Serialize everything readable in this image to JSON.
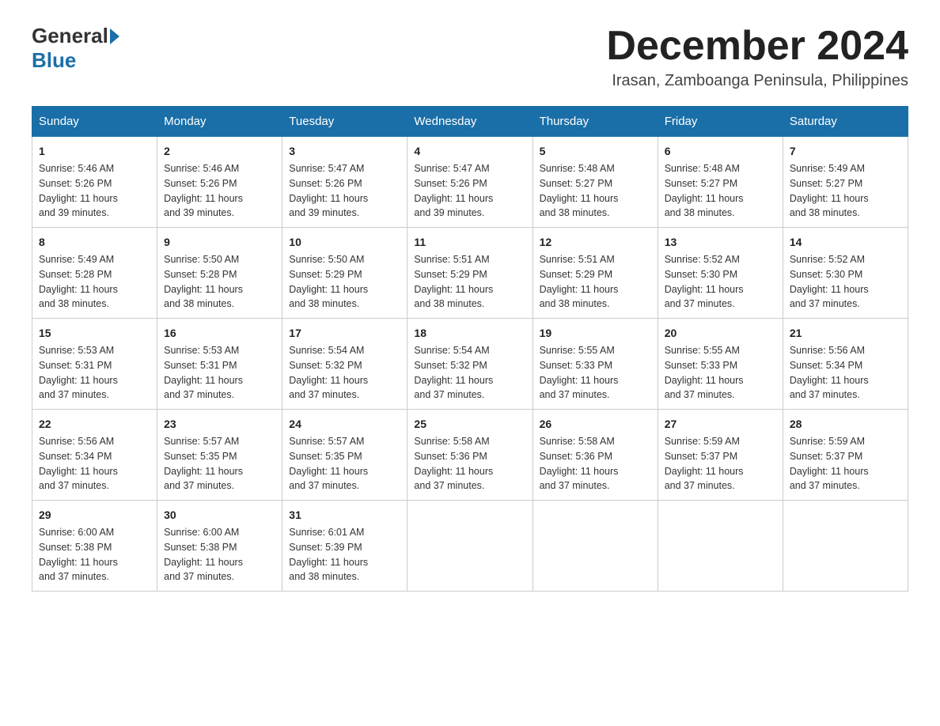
{
  "header": {
    "logo_general": "General",
    "logo_blue": "Blue",
    "month_title": "December 2024",
    "location": "Irasan, Zamboanga Peninsula, Philippines"
  },
  "weekdays": [
    "Sunday",
    "Monday",
    "Tuesday",
    "Wednesday",
    "Thursday",
    "Friday",
    "Saturday"
  ],
  "weeks": [
    [
      {
        "day": "1",
        "sunrise": "5:46 AM",
        "sunset": "5:26 PM",
        "daylight": "11 hours and 39 minutes."
      },
      {
        "day": "2",
        "sunrise": "5:46 AM",
        "sunset": "5:26 PM",
        "daylight": "11 hours and 39 minutes."
      },
      {
        "day": "3",
        "sunrise": "5:47 AM",
        "sunset": "5:26 PM",
        "daylight": "11 hours and 39 minutes."
      },
      {
        "day": "4",
        "sunrise": "5:47 AM",
        "sunset": "5:26 PM",
        "daylight": "11 hours and 39 minutes."
      },
      {
        "day": "5",
        "sunrise": "5:48 AM",
        "sunset": "5:27 PM",
        "daylight": "11 hours and 38 minutes."
      },
      {
        "day": "6",
        "sunrise": "5:48 AM",
        "sunset": "5:27 PM",
        "daylight": "11 hours and 38 minutes."
      },
      {
        "day": "7",
        "sunrise": "5:49 AM",
        "sunset": "5:27 PM",
        "daylight": "11 hours and 38 minutes."
      }
    ],
    [
      {
        "day": "8",
        "sunrise": "5:49 AM",
        "sunset": "5:28 PM",
        "daylight": "11 hours and 38 minutes."
      },
      {
        "day": "9",
        "sunrise": "5:50 AM",
        "sunset": "5:28 PM",
        "daylight": "11 hours and 38 minutes."
      },
      {
        "day": "10",
        "sunrise": "5:50 AM",
        "sunset": "5:29 PM",
        "daylight": "11 hours and 38 minutes."
      },
      {
        "day": "11",
        "sunrise": "5:51 AM",
        "sunset": "5:29 PM",
        "daylight": "11 hours and 38 minutes."
      },
      {
        "day": "12",
        "sunrise": "5:51 AM",
        "sunset": "5:29 PM",
        "daylight": "11 hours and 38 minutes."
      },
      {
        "day": "13",
        "sunrise": "5:52 AM",
        "sunset": "5:30 PM",
        "daylight": "11 hours and 37 minutes."
      },
      {
        "day": "14",
        "sunrise": "5:52 AM",
        "sunset": "5:30 PM",
        "daylight": "11 hours and 37 minutes."
      }
    ],
    [
      {
        "day": "15",
        "sunrise": "5:53 AM",
        "sunset": "5:31 PM",
        "daylight": "11 hours and 37 minutes."
      },
      {
        "day": "16",
        "sunrise": "5:53 AM",
        "sunset": "5:31 PM",
        "daylight": "11 hours and 37 minutes."
      },
      {
        "day": "17",
        "sunrise": "5:54 AM",
        "sunset": "5:32 PM",
        "daylight": "11 hours and 37 minutes."
      },
      {
        "day": "18",
        "sunrise": "5:54 AM",
        "sunset": "5:32 PM",
        "daylight": "11 hours and 37 minutes."
      },
      {
        "day": "19",
        "sunrise": "5:55 AM",
        "sunset": "5:33 PM",
        "daylight": "11 hours and 37 minutes."
      },
      {
        "day": "20",
        "sunrise": "5:55 AM",
        "sunset": "5:33 PM",
        "daylight": "11 hours and 37 minutes."
      },
      {
        "day": "21",
        "sunrise": "5:56 AM",
        "sunset": "5:34 PM",
        "daylight": "11 hours and 37 minutes."
      }
    ],
    [
      {
        "day": "22",
        "sunrise": "5:56 AM",
        "sunset": "5:34 PM",
        "daylight": "11 hours and 37 minutes."
      },
      {
        "day": "23",
        "sunrise": "5:57 AM",
        "sunset": "5:35 PM",
        "daylight": "11 hours and 37 minutes."
      },
      {
        "day": "24",
        "sunrise": "5:57 AM",
        "sunset": "5:35 PM",
        "daylight": "11 hours and 37 minutes."
      },
      {
        "day": "25",
        "sunrise": "5:58 AM",
        "sunset": "5:36 PM",
        "daylight": "11 hours and 37 minutes."
      },
      {
        "day": "26",
        "sunrise": "5:58 AM",
        "sunset": "5:36 PM",
        "daylight": "11 hours and 37 minutes."
      },
      {
        "day": "27",
        "sunrise": "5:59 AM",
        "sunset": "5:37 PM",
        "daylight": "11 hours and 37 minutes."
      },
      {
        "day": "28",
        "sunrise": "5:59 AM",
        "sunset": "5:37 PM",
        "daylight": "11 hours and 37 minutes."
      }
    ],
    [
      {
        "day": "29",
        "sunrise": "6:00 AM",
        "sunset": "5:38 PM",
        "daylight": "11 hours and 37 minutes."
      },
      {
        "day": "30",
        "sunrise": "6:00 AM",
        "sunset": "5:38 PM",
        "daylight": "11 hours and 37 minutes."
      },
      {
        "day": "31",
        "sunrise": "6:01 AM",
        "sunset": "5:39 PM",
        "daylight": "11 hours and 38 minutes."
      },
      null,
      null,
      null,
      null
    ]
  ],
  "labels": {
    "sunrise": "Sunrise:",
    "sunset": "Sunset:",
    "daylight": "Daylight:"
  }
}
